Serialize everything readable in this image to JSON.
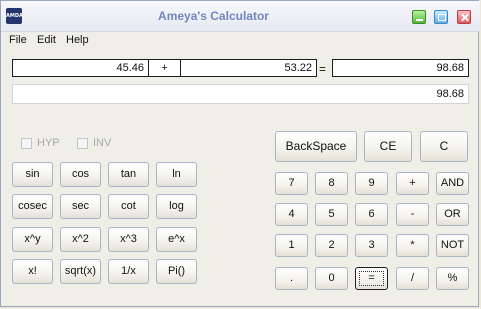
{
  "window": {
    "title": "Ameya's Calculator",
    "icon_text": "AMDA",
    "controls": [
      "minimize-icon",
      "maximize-icon",
      "close-icon"
    ]
  },
  "menu": [
    "File",
    "Edit",
    "Help"
  ],
  "expression": {
    "operand1": "45.46",
    "operator": "+",
    "operand2": "53.22",
    "equals": "=",
    "result": "98.68"
  },
  "display": "98.68",
  "checkboxes": [
    {
      "label": "HYP",
      "checked": false,
      "enabled": false
    },
    {
      "label": "INV",
      "checked": false,
      "enabled": false
    }
  ],
  "scientific_buttons": [
    [
      "sin",
      "cos",
      "tan",
      "ln"
    ],
    [
      "cosec",
      "sec",
      "cot",
      "log"
    ],
    [
      "x^y",
      "x^2",
      "x^3",
      "e^x"
    ],
    [
      "x!",
      "sqrt(x)",
      "1/x",
      "Pi()"
    ]
  ],
  "control_buttons": [
    "BackSpace",
    "CE",
    "C"
  ],
  "keypad": [
    [
      "7",
      "8",
      "9",
      "+",
      "AND"
    ],
    [
      "4",
      "5",
      "6",
      "-",
      "OR"
    ],
    [
      "1",
      "2",
      "3",
      "*",
      "NOT"
    ],
    [
      ".",
      "0",
      "=",
      "/",
      "%"
    ]
  ],
  "colors": {
    "title": "#7286bf",
    "window_bg": "#f0efe7",
    "disabled_text": "#a7a7a7"
  }
}
